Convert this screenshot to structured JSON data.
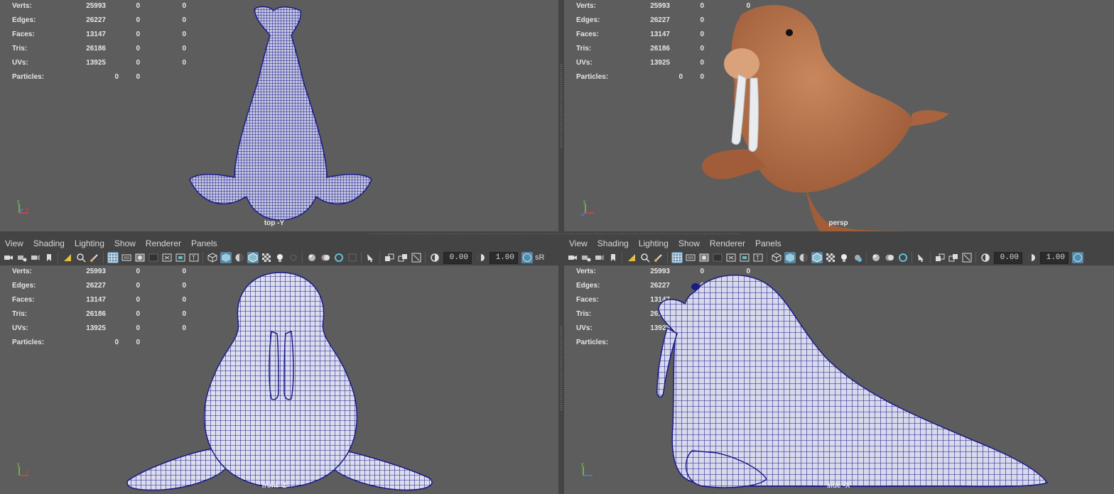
{
  "menus": [
    "View",
    "Shading",
    "Lighting",
    "Show",
    "Renderer",
    "Panels"
  ],
  "toolbar": {
    "field1": "0.00",
    "field2": "1.00",
    "overflow_text": "sR",
    "icons": [
      "select-camera-icon",
      "camera-attributes-icon",
      "bookmark-icon",
      "image-plane-icon",
      "2d-pan-zoom-icon",
      "grease-pencil-icon",
      "grid-icon",
      "film-gate-icon",
      "resolution-gate-icon",
      "gate-mask-icon",
      "field-chart-icon",
      "safe-action-icon",
      "safe-title-icon",
      "wireframe-icon",
      "smooth-shade-icon",
      "wireframe-on-shaded-icon",
      "textured-icon",
      "use-all-lights-icon",
      "shadows-icon",
      "ambient-occlusion-icon",
      "motion-blur-icon",
      "anti-aliasing-icon",
      "depth-of-field-icon",
      "isolate-select-icon",
      "xray-icon",
      "xray-joints-icon",
      "backface-culling-icon",
      "exposure-icon",
      "gamma-icon",
      "color-management-icon"
    ]
  },
  "stats": {
    "labels": [
      "Verts:",
      "Edges:",
      "Faces:",
      "Tris:",
      "UVs:",
      "Particles:"
    ],
    "rows": [
      {
        "label": "Verts:",
        "v1": "25993",
        "v2": "0",
        "v3": "0"
      },
      {
        "label": "Edges:",
        "v1": "26227",
        "v2": "0",
        "v3": "0"
      },
      {
        "label": "Faces:",
        "v1": "13147",
        "v2": "0",
        "v3": "0"
      },
      {
        "label": "Tris:",
        "v1": "26186",
        "v2": "0",
        "v3": "0"
      },
      {
        "label": "UVs:",
        "v1": "13925",
        "v2": "0",
        "v3": "0"
      }
    ],
    "particles": {
      "label": "Particles:",
      "v1": "0",
      "v2": "0"
    }
  },
  "viewports": {
    "top": {
      "camera": "top -Y"
    },
    "persp": {
      "camera": "persp"
    },
    "front": {
      "camera": "front -Z"
    },
    "side": {
      "camera": "side -X"
    }
  },
  "colors": {
    "viewport_bg": "#5d5d5d",
    "wireframe": "#1a1a8a",
    "walrus_skin": "#b8734a",
    "tusk": "#e8ecef",
    "active_icon": "#5b87a6"
  }
}
